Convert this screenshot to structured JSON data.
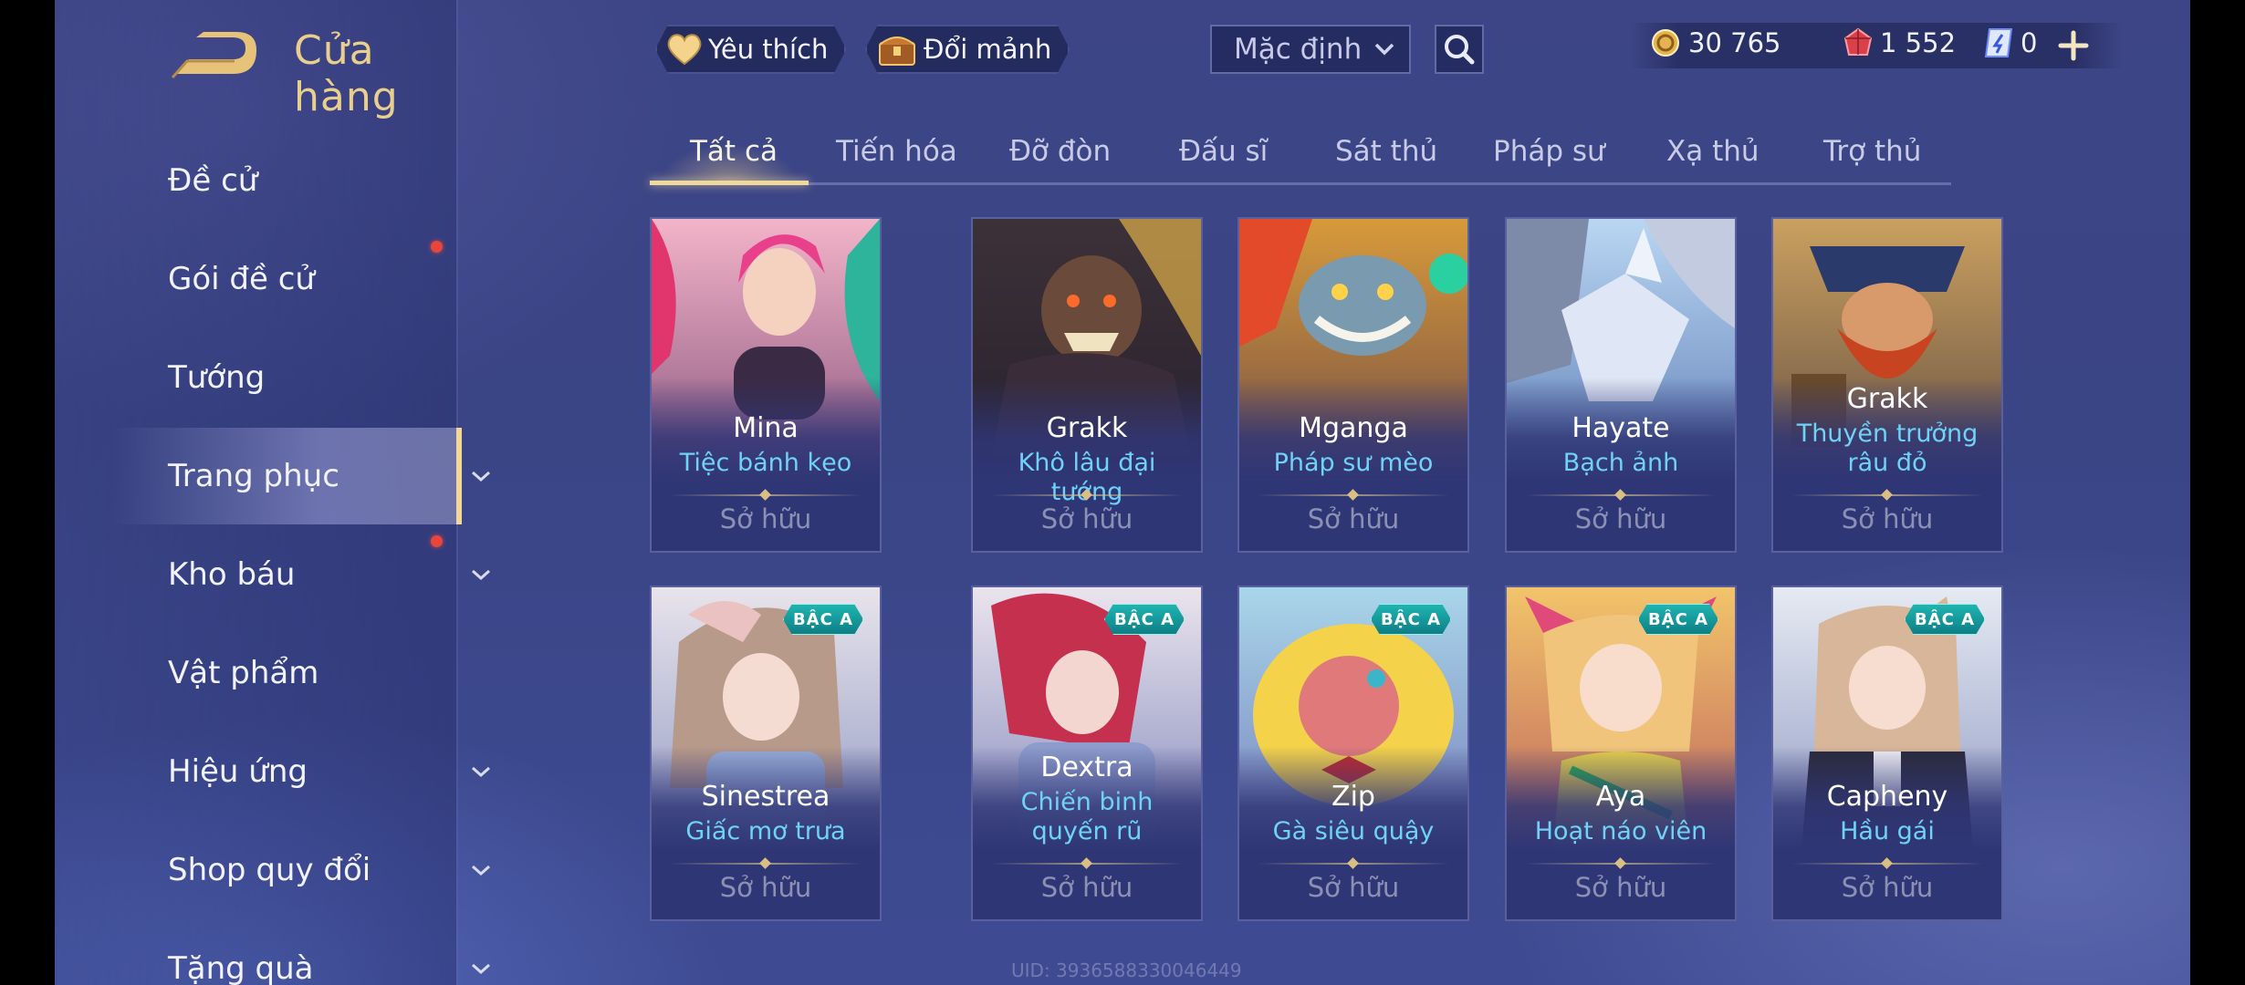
{
  "header": {
    "title": "Cửa hàng",
    "favorite_label": "Yêu thích",
    "exchange_label": "Đổi mảnh",
    "sort_value": "Mặc định"
  },
  "currency": {
    "gold": "30 765",
    "vouchers": "1 552",
    "tickets": "0"
  },
  "sidebar": {
    "items": [
      {
        "label": "Đề cử"
      },
      {
        "label": "Gói đề cử"
      },
      {
        "label": "Tướng"
      },
      {
        "label": "Trang phục"
      },
      {
        "label": "Kho báu"
      },
      {
        "label": "Vật phẩm"
      },
      {
        "label": "Hiệu ứng"
      },
      {
        "label": "Shop quy đổi"
      },
      {
        "label": "Tặng quà"
      }
    ]
  },
  "tabs": [
    {
      "label": "Tất cả"
    },
    {
      "label": "Tiến hóa"
    },
    {
      "label": "Đỡ đòn"
    },
    {
      "label": "Đấu sĩ"
    },
    {
      "label": "Sát thủ"
    },
    {
      "label": "Pháp sư"
    },
    {
      "label": "Xạ thủ"
    },
    {
      "label": "Trợ thủ"
    }
  ],
  "cards": [
    {
      "hero": "Mina",
      "skin": "Tiệc bánh kẹo",
      "status": "Sở hữu"
    },
    {
      "hero": "Grakk",
      "skin": "Khô lâu đại tướng",
      "status": "Sở hữu"
    },
    {
      "hero": "Mganga",
      "skin": "Pháp sư mèo",
      "status": "Sở hữu"
    },
    {
      "hero": "Hayate",
      "skin": "Bạch ảnh",
      "status": "Sở hữu"
    },
    {
      "hero": "Grakk",
      "skin": "Thuyền trưởng râu đỏ",
      "status": "Sở hữu"
    },
    {
      "hero": "Sinestrea",
      "skin": "Giấc mơ trưa",
      "status": "Sở hữu",
      "badge": "BẬC A"
    },
    {
      "hero": "Dextra",
      "skin": "Chiến binh quyến rũ",
      "status": "Sở hữu",
      "badge": "BẬC A"
    },
    {
      "hero": "Zip",
      "skin": "Gà siêu quậy",
      "status": "Sở hữu",
      "badge": "BẬC A"
    },
    {
      "hero": "Aya",
      "skin": "Hoạt náo viên",
      "status": "Sở hữu",
      "badge": "BẬC A"
    },
    {
      "hero": "Capheny",
      "skin": "Hầu gái",
      "status": "Sở hữu",
      "badge": "BẬC A"
    }
  ],
  "uid": "UID: 3936588330046449"
}
